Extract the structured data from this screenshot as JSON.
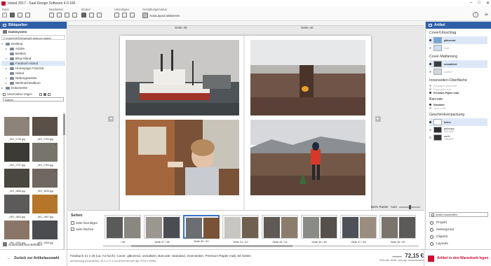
{
  "window": {
    "title": "Island 2017 - Saal Design Software 4.0.166"
  },
  "toolbar": {
    "groups": [
      "Datei",
      "Bearbeiten",
      "Modus",
      "Hinzufügen",
      "Gestaltungsmodus"
    ],
    "autolayout_label": "AutoLayout aktivieren",
    "language": "de"
  },
  "left": {
    "header": "Bildquellen",
    "source": "Dateisystem",
    "path": "C:\\Users\\SD\\Desktop\\Fotobuch Island",
    "tree": [
      {
        "label": "Desktop",
        "level": 0
      },
      {
        "label": "Adobe",
        "level": 1
      },
      {
        "label": "Beetles",
        "level": 1
      },
      {
        "label": "Blog Island",
        "level": 1
      },
      {
        "label": "Fotobuch Island",
        "level": 1
      },
      {
        "label": "Homepage Fotoclub",
        "level": 1
      },
      {
        "label": "Island",
        "level": 1
      },
      {
        "label": "Nebengewerbe",
        "level": 1
      },
      {
        "label": "Weihnachtsalbum",
        "level": 1
      },
      {
        "label": "Dokumente",
        "level": 0
      }
    ],
    "hidden_label": "Unterordner zeigen",
    "sort_label": "Datum",
    "thumbs": [
      {
        "name": "_MG_1715.jpg",
        "color": "#8c8478"
      },
      {
        "name": "_MG_1794.jpg",
        "color": "#5a5048"
      },
      {
        "name": "_MG_1737.jpg",
        "color": "#3b3a34"
      },
      {
        "name": "_MG_1784.jpg",
        "color": "#77746b"
      },
      {
        "name": "_MG_1866.jpg",
        "color": "#4a4640"
      },
      {
        "name": "_MG_1834.jpg",
        "color": "#6f6860"
      },
      {
        "name": "_MG_1853.jpg",
        "color": "#5c5a5b"
      },
      {
        "name": "_MG_1867.jpg",
        "color": "#b5762a"
      },
      {
        "name": "_MG_1901.jpg",
        "color": "#8a7666"
      },
      {
        "name": "_MG_1905.jpg",
        "color": "#4b4c50"
      }
    ],
    "autofill": "Automatisches Befüllen"
  },
  "center": {
    "page_left": "Seite 39",
    "page_right": "Seite 40",
    "zoom_fit": "Beim Raster",
    "zoom_auto": "Auto"
  },
  "strip": {
    "title": "Seiten",
    "add_pages": "Seite hinzufügen",
    "delete_pages": "Seite löschen",
    "pages": [
      {
        "label": "/ 36"
      },
      {
        "label": "Seite 37 / 38"
      },
      {
        "label": "Seite 39 / 40"
      },
      {
        "label": "Seite 41 / 42"
      },
      {
        "label": "Seite 43 / 44"
      },
      {
        "label": "Seite 45 / 46"
      },
      {
        "label": "Seite 47 / 48"
      },
      {
        "label": "Seite 49 / 50"
      }
    ]
  },
  "right": {
    "header": "Artikel",
    "sections": {
      "cover": {
        "title": "Cover/Umschlag",
        "opt1": "glänzend",
        "opt2": "matt"
      },
      "cover_finish": {
        "title": "Cover-Mattierung",
        "opt1": "unmattiert",
        "opt2": "mattiert"
      },
      "inner": {
        "title": "Innenseiten-Oberfläche",
        "o1": "Fotopapier glänzend",
        "o2": "Fotopapier matt",
        "o3": "Premium-Papier matt"
      },
      "barcode": {
        "title": "Barcode",
        "o1": "Standard",
        "o2": "ohne Code"
      },
      "gift": {
        "title": "Geschenkverpackung",
        "o1": "keine",
        "o2": "gelbrapp",
        "o2p": "+20,00 €",
        "o3": "weiß",
        "o3p": "+20,00 €"
      }
    },
    "article_btn": "Artikel umwandeln",
    "nav": [
      "Projekt",
      "Hintergrund",
      "Cliparts",
      "Layouts"
    ]
  },
  "status": {
    "back": "Zurück zur Artikelauswahl",
    "line1": "Fotobuch 21 x 26 (ca. A4 hoch): Cover: glänzend, unmattiert, Barcode: Standard, Innenseiten: Premium-Papier matt, 84 Seiten",
    "line2": "Abmessung (innensiete): 42,0 x 27,0 cm (Pixel bei 600 dpi: 9709 x 6390)",
    "price_old": "89,99 €",
    "price_new": "72,15 €",
    "price_note": "Preis inkl. MwSt. und zzgl. Versandkosten",
    "cart": "Artikel in den Warenkorb legen"
  }
}
